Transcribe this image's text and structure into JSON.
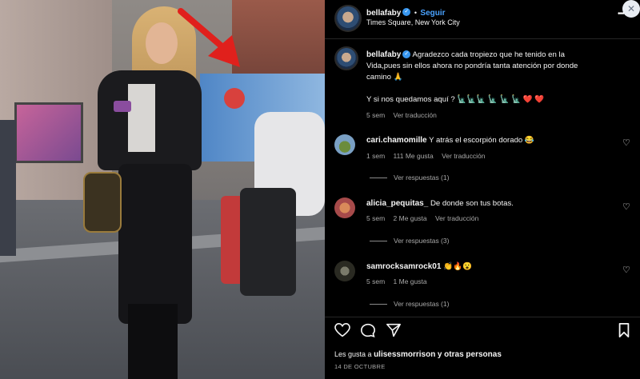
{
  "post": {
    "username": "bellafaby",
    "follow_label": "Seguir",
    "separator": "•",
    "location": "Times Square, New York City"
  },
  "caption": {
    "username": "bellafaby",
    "line1": "Agradezco cada tropiezo que he tenido en la",
    "line2": "Vida,pues sin ellos ahora no pondría tanta atención por donde",
    "line3": "camino 🙏",
    "line4": "Y si nos quedamos aquí ? 🗽🗽🗽 🗽 🗽 🗽 ❤️ ❤️",
    "time": "5 sem",
    "translate": "Ver traducción"
  },
  "comments": [
    {
      "username": "cari.chamomille",
      "text": "Y atrás el escorpión dorado 😂",
      "time": "1 sem",
      "likes": "111 Me gusta",
      "translate": "Ver traducción",
      "replies": "Ver respuestas (1)"
    },
    {
      "username": "alicia_pequitas_",
      "text": "De donde son tus botas.",
      "time": "5 sem",
      "likes": "2 Me gusta",
      "translate": "Ver traducción",
      "replies": "Ver respuestas (3)"
    },
    {
      "username": "samrocksamrock01",
      "text": "👏🔥😮",
      "time": "5 sem",
      "likes": "1 Me gusta",
      "replies": "Ver respuestas (1)"
    }
  ],
  "likes_line": {
    "prefix": "Les gusta a",
    "user": "ulisessmorrison",
    "suffix": "y otras personas"
  },
  "date": "14 DE OCTUBRE",
  "icons": {
    "verified": "✓",
    "more": "•••",
    "close": "✕",
    "heart": "♡"
  },
  "colors": {
    "accent": "#3897f0",
    "arrow": "#e0201c"
  }
}
